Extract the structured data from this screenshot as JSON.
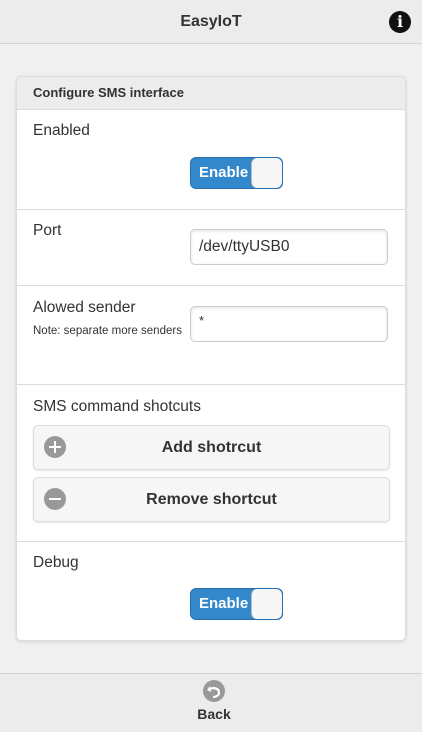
{
  "header": {
    "title": "EasyIoT",
    "info_icon": "info-icon"
  },
  "card": {
    "title": "Configure SMS interface",
    "enabled": {
      "label": "Enabled",
      "toggle_label": "Enable",
      "state": "on"
    },
    "port": {
      "label": "Port",
      "value": "/dev/ttyUSB0"
    },
    "allowed_sender": {
      "label": "Alowed sender",
      "note": "Note: separate more senders",
      "value": "*"
    },
    "shortcuts": {
      "label": "SMS command shotcuts",
      "add_label": "Add shotrcut",
      "remove_label": "Remove shortcut"
    },
    "debug": {
      "label": "Debug",
      "toggle_label": "Enable",
      "state": "on"
    }
  },
  "footer": {
    "back_label": "Back"
  },
  "colors": {
    "accent": "#3388cc",
    "header_bg": "#ececec",
    "icon_gray": "#999999"
  }
}
